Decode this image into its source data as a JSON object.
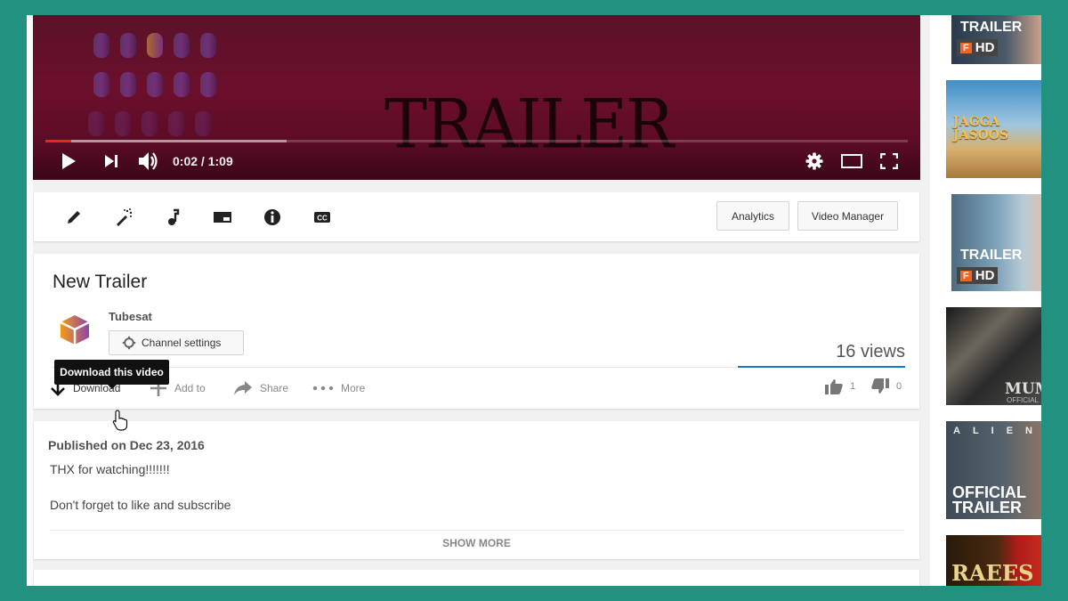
{
  "player": {
    "overlay_title": "TRAILER",
    "time_current": "0:02",
    "time_separator": " / ",
    "time_total": "1:09",
    "played_fraction": 0.03,
    "buffered_fraction": 0.28,
    "icons": [
      "play-icon",
      "next-icon",
      "volume-icon",
      "settings-icon",
      "theater-mode-icon",
      "fullscreen-icon"
    ]
  },
  "toolbar": {
    "tools": [
      "edit-icon",
      "enhance-icon",
      "audio-icon",
      "end-screen-icon",
      "info-icon",
      "subtitles-icon"
    ],
    "analytics_label": "Analytics",
    "video_manager_label": "Video Manager"
  },
  "video": {
    "title": "New Trailer",
    "channel_name": "Tubesat",
    "channel_settings_label": "Channel settings",
    "views": "16 views",
    "likes": "1",
    "dislikes": "0",
    "actions": {
      "download": "Download",
      "add_to": "Add to",
      "share": "Share",
      "more": "More"
    },
    "tooltip": "Download this video"
  },
  "description": {
    "published": "Published on Dec 23, 2016",
    "lines": [
      "THX for watching!!!!!!!",
      "Don't forget to like and subscribe"
    ],
    "show_more": "SHOW MORE"
  },
  "sidebar": {
    "thumbnails": [
      {
        "label": "TRAILER",
        "badge": "HD"
      },
      {
        "label": "JAGGA JASOOS"
      },
      {
        "label": "TRAILER",
        "badge": "HD"
      },
      {
        "label": "MUMMY",
        "sub": "OFFICIAL T"
      },
      {
        "label": "OFFICIAL TRAILER",
        "top": "ALIEN"
      },
      {
        "label": "RAEES"
      }
    ]
  },
  "colors": {
    "accent_blue": "#167ac6",
    "progress_red": "#ee2222",
    "background_teal": "#23917f"
  }
}
